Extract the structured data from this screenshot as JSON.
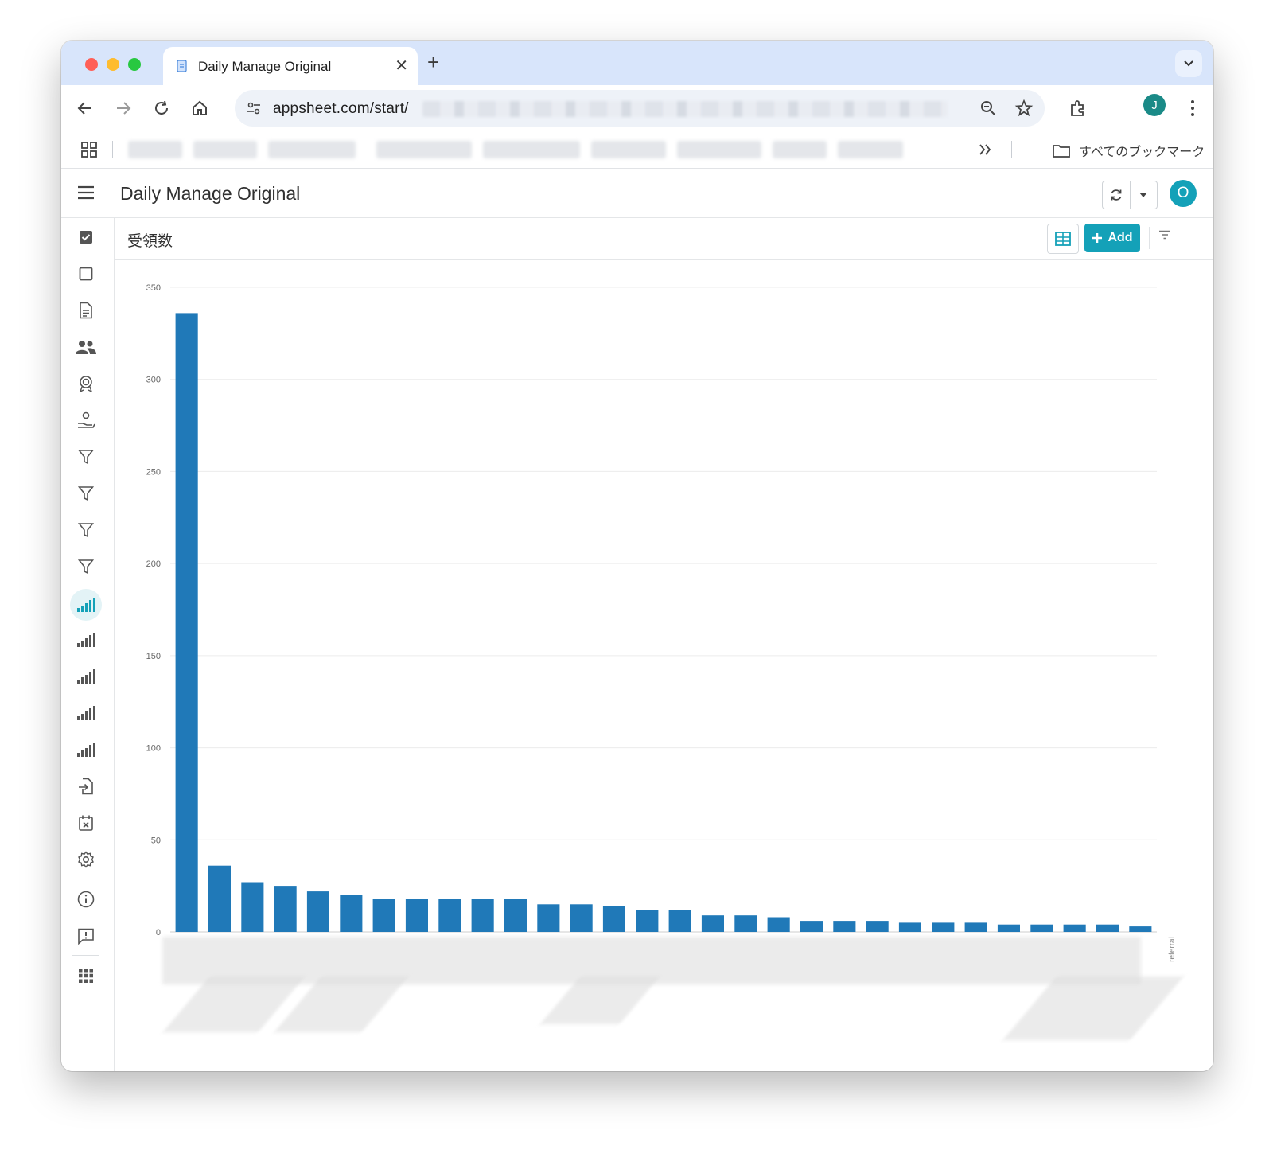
{
  "browser": {
    "tab_title": "Daily Manage Original",
    "url_visible": "appsheet.com/start/",
    "all_bookmarks_label": "すべてのブックマーク",
    "profile_initial": "J"
  },
  "app": {
    "title": "Daily Manage Original",
    "user_initial": "O",
    "accent_color": "#14a1b8"
  },
  "view": {
    "title": "受領数",
    "add_label": "Add"
  },
  "sidebar": {
    "items": [
      {
        "icon": "checkbox-checked-icon"
      },
      {
        "icon": "checkbox-empty-icon"
      },
      {
        "icon": "document-icon"
      },
      {
        "icon": "people-icon"
      },
      {
        "icon": "award-icon"
      },
      {
        "icon": "hand-person-icon"
      },
      {
        "icon": "filter-icon"
      },
      {
        "icon": "filter-icon"
      },
      {
        "icon": "filter-icon"
      },
      {
        "icon": "filter-icon"
      },
      {
        "icon": "bar-chart-icon",
        "active": true
      },
      {
        "icon": "bar-chart-icon"
      },
      {
        "icon": "bar-chart-icon"
      },
      {
        "icon": "bar-chart-icon"
      },
      {
        "icon": "bar-chart-icon"
      },
      {
        "icon": "import-icon"
      },
      {
        "icon": "calendar-x-icon"
      },
      {
        "icon": "settings-icon"
      },
      {
        "icon": "info-icon"
      },
      {
        "icon": "feedback-icon"
      },
      {
        "icon": "apps-grid-icon"
      }
    ]
  },
  "chart_data": {
    "type": "bar",
    "color": "#2079b8",
    "ylim": [
      0,
      350
    ],
    "yticks": [
      0,
      50,
      100,
      150,
      200,
      250,
      300,
      350
    ],
    "values": [
      336,
      36,
      27,
      25,
      22,
      20,
      18,
      18,
      18,
      18,
      18,
      15,
      15,
      14,
      12,
      12,
      9,
      9,
      8,
      6,
      6,
      6,
      5,
      5,
      5,
      4,
      4,
      4,
      4,
      3
    ],
    "categories_obscured": true,
    "right_axis_label": "referral",
    "grid": true
  }
}
